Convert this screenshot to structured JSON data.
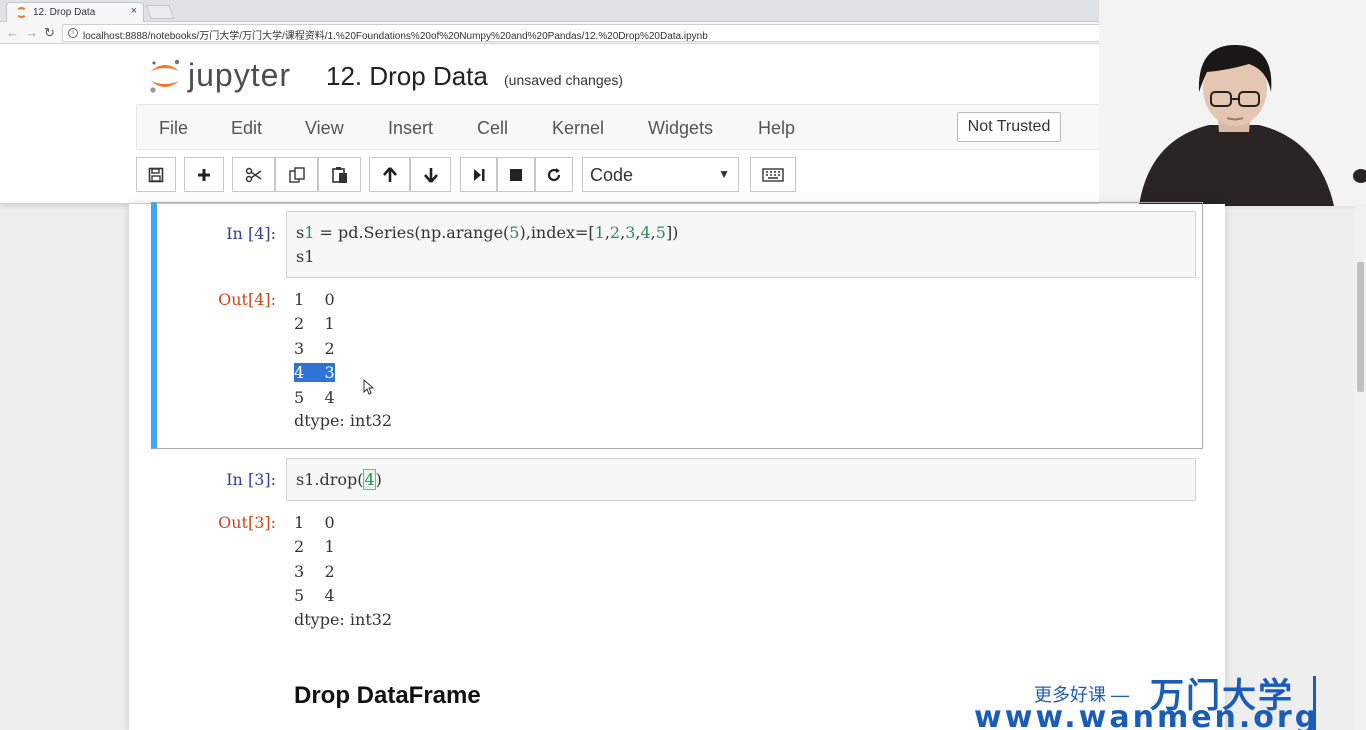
{
  "browser": {
    "tab_title": "12. Drop Data",
    "tab_close": "×",
    "url": "localhost:8888/notebooks/万门大学/万门大学/课程资料/1.%20Foundations%20of%20Numpy%20and%20Pandas/12.%20Drop%20Data.ipynb"
  },
  "jupyter": {
    "logo_text": "jupyter",
    "notebook_title": "12. Drop Data",
    "status": "(unsaved changes)",
    "menu": [
      "File",
      "Edit",
      "View",
      "Insert",
      "Cell",
      "Kernel",
      "Widgets",
      "Help"
    ],
    "trusted": "Not Trusted",
    "cell_type": "Code"
  },
  "cells": {
    "c1": {
      "in_prompt": "In  [4]:",
      "code_line1": "s1 = pd.Series(np.arange(5),index=[1,2,3,4,5])",
      "code_line2": "s1",
      "out_prompt": "Out[4]:",
      "output": [
        {
          "idx": "1",
          "val": "0"
        },
        {
          "idx": "2",
          "val": "1"
        },
        {
          "idx": "3",
          "val": "2"
        },
        {
          "idx": "4",
          "val": "3"
        },
        {
          "idx": "5",
          "val": "4"
        }
      ],
      "dtype": "dtype: int32"
    },
    "c2": {
      "in_prompt": "In  [3]:",
      "code": "s1.drop(4)",
      "out_prompt": "Out[3]:",
      "output": [
        {
          "idx": "1",
          "val": "0"
        },
        {
          "idx": "2",
          "val": "1"
        },
        {
          "idx": "3",
          "val": "2"
        },
        {
          "idx": "5",
          "val": "4"
        }
      ],
      "dtype": "dtype: int32"
    }
  },
  "markdown": {
    "heading": "Drop DataFrame"
  },
  "watermark": {
    "slogan": "更多好课 —",
    "brand": "万门大学",
    "url": "www.wanmen.org"
  }
}
